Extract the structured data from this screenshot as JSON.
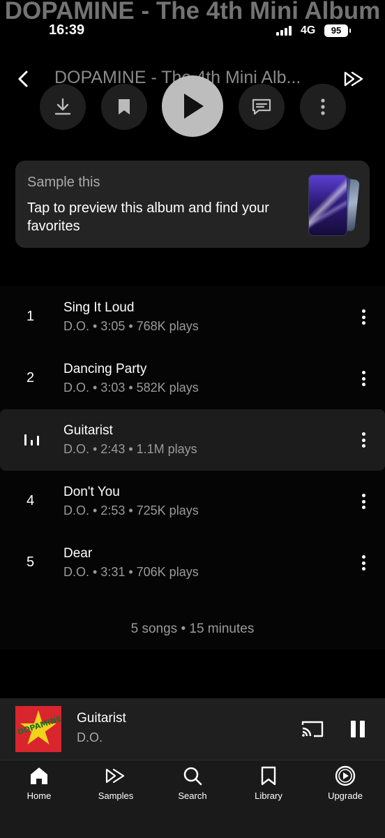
{
  "album_title_faded": "DOPAMINE - The 4th Mini Album",
  "status_bar": {
    "time": "16:39",
    "network": "4G",
    "battery": "95"
  },
  "header": {
    "title": "DOPAMINE - The 4th Mini Alb..."
  },
  "actions": {
    "icons": [
      "download-icon",
      "bookmark-icon",
      "play-icon",
      "comment-icon",
      "more-vertical-icon"
    ]
  },
  "sample_card": {
    "label": "Sample this",
    "description": "Tap to preview this album and find your favorites"
  },
  "tracks": [
    {
      "number": "1",
      "title": "Sing It Loud",
      "meta": "D.O. • 3:05 • 768K plays",
      "playing": false
    },
    {
      "number": "2",
      "title": "Dancing Party",
      "meta": "D.O. • 3:03 • 582K plays",
      "playing": false
    },
    {
      "number": "3",
      "title": "Guitarist",
      "meta": "D.O. • 2:43 • 1.1M plays",
      "playing": true
    },
    {
      "number": "4",
      "title": "Don't You",
      "meta": "D.O. • 2:53 • 725K plays",
      "playing": false
    },
    {
      "number": "5",
      "title": "Dear",
      "meta": "D.O. • 3:31 • 706K plays",
      "playing": false
    }
  ],
  "summary": "5 songs • 15 minutes",
  "mini_player": {
    "title": "Guitarist",
    "artist": "D.O.",
    "art_text": "DOPAMINE"
  },
  "bottom_nav": [
    {
      "label": "Home",
      "icon": "home-icon",
      "selected": true
    },
    {
      "label": "Samples",
      "icon": "samples-icon",
      "selected": false
    },
    {
      "label": "Search",
      "icon": "search-icon",
      "selected": false
    },
    {
      "label": "Library",
      "icon": "library-icon",
      "selected": false
    },
    {
      "label": "Upgrade",
      "icon": "upgrade-icon",
      "selected": false
    }
  ],
  "colors": {
    "background": "#000000",
    "card": "#242424",
    "active_row": "#1c1c1c",
    "play_button": "#bdbdbd",
    "secondary_text": "#9a9a9a",
    "nav_bar": "#1a1a1a"
  }
}
